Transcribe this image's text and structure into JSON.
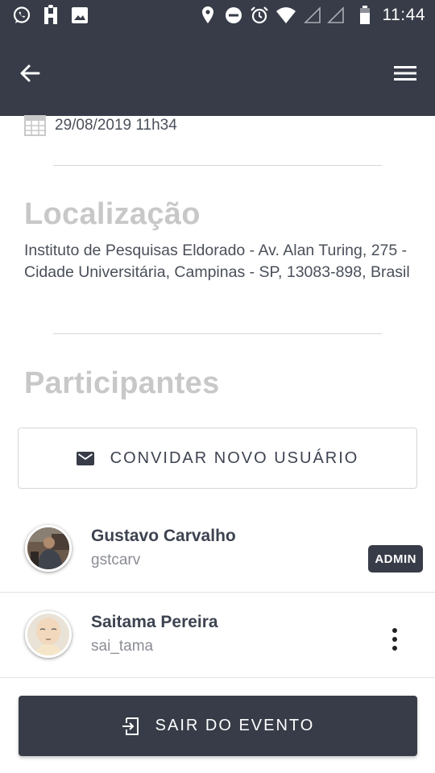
{
  "status_bar": {
    "time": "11:44",
    "icons": [
      "whatsapp-icon",
      "h-app-icon",
      "gallery-icon",
      "location-icon",
      "do-not-disturb-icon",
      "alarm-icon",
      "wifi-icon",
      "signal-icon",
      "signal-icon",
      "battery-icon"
    ]
  },
  "app_bar": {
    "back_icon": "arrow-back-icon",
    "menu_icon": "hamburger-menu-icon"
  },
  "event": {
    "date_icon": "calendar-icon",
    "date": "29/08/2019 11h34",
    "location_title": "Localização",
    "address": "Instituto de Pesquisas Eldorado - Av. Alan Turing, 275 - Cidade Universitária, Campinas - SP, 13083-898, Brasil"
  },
  "participants_section": {
    "title": "Participantes",
    "invite_button": {
      "icon": "mail-icon",
      "label": "CONVIDAR NOVO USUÁRIO"
    },
    "participants": [
      {
        "name": "Gustavo Carvalho",
        "username": "gstcarv",
        "badge": "ADMIN"
      },
      {
        "name": "Saitama Pereira",
        "username": "sai_tama",
        "action_icon": "more-vert-icon"
      }
    ]
  },
  "leave_button": {
    "icon": "exit-icon",
    "label": "SAIR DO EVENTO"
  },
  "colors": {
    "primary": "#373c48",
    "text": "#3d4350",
    "muted": "#8a8d94",
    "heading_muted": "#c8c8c8",
    "divider": "#d8d8d8"
  }
}
